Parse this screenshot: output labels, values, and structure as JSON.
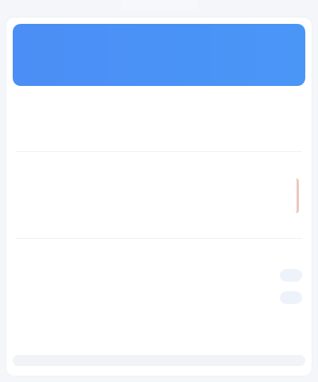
{
  "topbar": {
    "label": ""
  },
  "header": {
    "title": ""
  },
  "summary": [
    {
      "label": "",
      "value": ""
    },
    {
      "label": "",
      "value": ""
    },
    {
      "label": "",
      "value": ""
    }
  ],
  "details": {
    "headline": "",
    "headline_caption": "",
    "lines": [
      "",
      "",
      "",
      "",
      "",
      ""
    ]
  },
  "panel": {
    "title": "",
    "subtitle": "",
    "rows": [
      {
        "label": "",
        "chip": ""
      },
      {
        "label": "",
        "chip": ""
      }
    ]
  },
  "footer": {
    "primary": "",
    "meta": ""
  },
  "colors": {
    "header_blue": "#4b8ef5",
    "positive_green": "#33a853",
    "negative_red": "#e24f4a",
    "muted_text": "#8f97a4"
  },
  "icons": {
    "edge_indicator": "edge-indicator-icon"
  }
}
